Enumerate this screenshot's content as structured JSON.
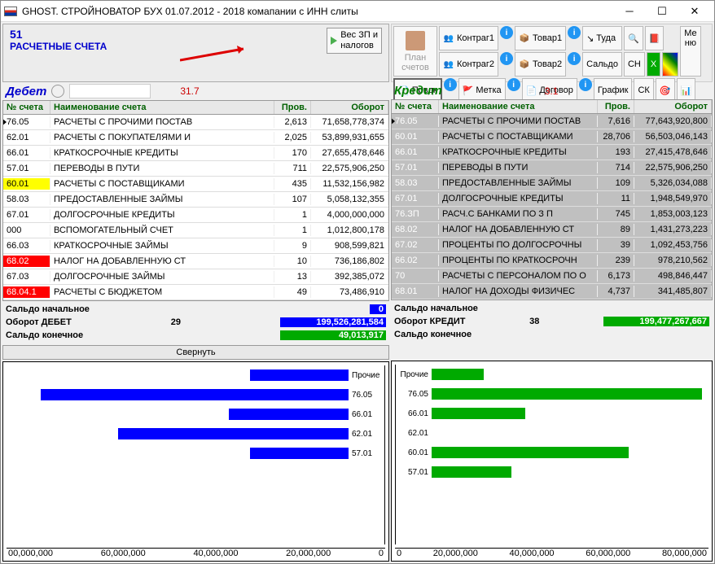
{
  "window": {
    "title": "GHOST. СТРОЙНОВАТОР БУХ 01.07.2012 - 2018 комапании с ИНН слиты"
  },
  "header": {
    "account_no": "51",
    "account_name": "РАСЧЕТНЫЕ СЧЕТА",
    "ves_btn": "Вес ЗП и\nналогов"
  },
  "toolbar": {
    "plan": "План\nсчетов",
    "kontrag1": "Контраг1",
    "kontrag2": "Контраг2",
    "tovar1": "Товар1",
    "tovar2": "Товар2",
    "tuda": "Туда",
    "saldo": "Сальдо",
    "sn": "СН",
    "sk": "СК",
    "menu": "Ме\nню",
    "prvdk": "Првдк",
    "metka": "Метка",
    "dogovor": "Договор",
    "grafik": "График"
  },
  "debit": {
    "label": "Дебет",
    "section_num": "31.7",
    "cols": {
      "num": "№ счета",
      "name": "Наименование счета",
      "prov": "Пров.",
      "obor": "Оборот"
    },
    "rows": [
      {
        "num": "76.05",
        "name": "РАСЧЕТЫ С ПРОЧИМИ ПОСТАВ",
        "prov": "2,613",
        "obor": "71,658,778,374",
        "numcls": ""
      },
      {
        "num": "62.01",
        "name": "РАСЧЕТЫ С ПОКУПАТЕЛЯМИ И",
        "prov": "2,025",
        "obor": "53,899,931,655",
        "numcls": ""
      },
      {
        "num": "66.01",
        "name": "КРАТКОСРОЧНЫЕ КРЕДИТЫ",
        "prov": "170",
        "obor": "27,655,478,646",
        "numcls": ""
      },
      {
        "num": "57.01",
        "name": "ПЕРЕВОДЫ В ПУТИ",
        "prov": "711",
        "obor": "22,575,906,250",
        "numcls": ""
      },
      {
        "num": "60.01",
        "name": "РАСЧЕТЫ С ПОСТАВЩИКАМИ",
        "prov": "435",
        "obor": "11,532,156,982",
        "numcls": "yellow-cell"
      },
      {
        "num": "58.03",
        "name": "ПРЕДОСТАВЛЕННЫЕ ЗАЙМЫ",
        "prov": "107",
        "obor": "5,058,132,355",
        "numcls": ""
      },
      {
        "num": "67.01",
        "name": "ДОЛГОСРОЧНЫЕ КРЕДИТЫ",
        "prov": "1",
        "obor": "4,000,000,000",
        "numcls": ""
      },
      {
        "num": "000",
        "name": "ВСПОМОГАТЕЛЬНЫЙ СЧЕТ",
        "prov": "1",
        "obor": "1,012,800,178",
        "numcls": ""
      },
      {
        "num": "66.03",
        "name": "КРАТКОСРОЧНЫЕ ЗАЙМЫ",
        "prov": "9",
        "obor": "908,599,821",
        "numcls": ""
      },
      {
        "num": "68.02",
        "name": "НАЛОГ НА ДОБАВЛЕННУЮ СТ",
        "prov": "10",
        "obor": "736,186,802",
        "numcls": "red-cell"
      },
      {
        "num": "67.03",
        "name": "ДОЛГОСРОЧНЫЕ ЗАЙМЫ",
        "prov": "13",
        "obor": "392,385,072",
        "numcls": ""
      },
      {
        "num": "68.04.1",
        "name": "РАСЧЕТЫ С БЮДЖЕТОМ",
        "prov": "49",
        "obor": "73,486,910",
        "numcls": "red-cell"
      }
    ],
    "summary": {
      "start_lbl": "Сальдо начальное",
      "start_val": "0",
      "obor_lbl": "Оборот ДЕБЕТ",
      "obor_cnt": "29",
      "obor_val": "199,526,281,584",
      "end_lbl": "Сальдо конечное",
      "end_val": "49,013,917"
    },
    "collapse": "Свернуть"
  },
  "credit": {
    "label": "Кредит",
    "section_num": "3.1",
    "cols": {
      "num": "№ счета",
      "name": "Наименование счета",
      "prov": "Пров.",
      "obor": "Оборот"
    },
    "rows": [
      {
        "num": "76.05",
        "name": "РАСЧЕТЫ С ПРОЧИМИ ПОСТАВ",
        "prov": "7,616",
        "obor": "77,643,920,800"
      },
      {
        "num": "60.01",
        "name": "РАСЧЕТЫ С ПОСТАВЩИКАМИ",
        "prov": "28,706",
        "obor": "56,503,046,143"
      },
      {
        "num": "66.01",
        "name": "КРАТКОСРОЧНЫЕ КРЕДИТЫ",
        "prov": "193",
        "obor": "27,415,478,646"
      },
      {
        "num": "57.01",
        "name": "ПЕРЕВОДЫ В ПУТИ",
        "prov": "714",
        "obor": "22,575,906,250"
      },
      {
        "num": "58.03",
        "name": "ПРЕДОСТАВЛЕННЫЕ ЗАЙМЫ",
        "prov": "109",
        "obor": "5,326,034,088"
      },
      {
        "num": "67.01",
        "name": "ДОЛГОСРОЧНЫЕ КРЕДИТЫ",
        "prov": "11",
        "obor": "1,948,549,970"
      },
      {
        "num": "76.ЗП",
        "name": "РАСЧ.С БАНКАМИ ПО З П",
        "prov": "745",
        "obor": "1,853,003,123"
      },
      {
        "num": "68.02",
        "name": "НАЛОГ НА ДОБАВЛЕННУЮ СТ",
        "prov": "89",
        "obor": "1,431,273,223"
      },
      {
        "num": "67.02",
        "name": "ПРОЦЕНТЫ ПО ДОЛГОСРОЧНЫ",
        "prov": "39",
        "obor": "1,092,453,756"
      },
      {
        "num": "66.02",
        "name": "ПРОЦЕНТЫ ПО КРАТКОСРОЧН",
        "prov": "239",
        "obor": "978,210,562"
      },
      {
        "num": "70",
        "name": "РАСЧЕТЫ С ПЕРСОНАЛОМ ПО О",
        "prov": "6,173",
        "obor": "498,846,447"
      },
      {
        "num": "68.01",
        "name": "НАЛОГ НА ДОХОДЫ ФИЗИЧЕС",
        "prov": "4,737",
        "obor": "341,485,807"
      }
    ],
    "summary": {
      "start_lbl": "Сальдо начальное",
      "obor_lbl": "Оборот КРЕДИТ",
      "obor_cnt": "38",
      "obor_val": "199,477,267,667",
      "end_lbl": "Сальдо конечное"
    }
  },
  "chart_data": [
    {
      "type": "bar",
      "orientation": "horizontal",
      "categories": [
        "Прочие",
        "76.05",
        "66.01",
        "62.01",
        "57.01"
      ],
      "values": [
        23000000000,
        72000000000,
        28000000000,
        54000000000,
        23000000000
      ],
      "xlim": [
        0,
        80000000000
      ],
      "ticks": [
        "00,000,000",
        "60,000,000",
        "40,000,000",
        "20,000,000",
        "0"
      ],
      "color": "#0000ff"
    },
    {
      "type": "bar",
      "orientation": "horizontal",
      "categories": [
        "Прочие",
        "76.05",
        "66.01",
        "62.01",
        "60.01",
        "57.01"
      ],
      "values": [
        15000000000,
        78000000000,
        27000000000,
        0,
        57000000000,
        23000000000
      ],
      "xlim": [
        0,
        80000000000
      ],
      "ticks": [
        "0",
        "20,000,000",
        "40,000,000",
        "60,000,000",
        "80,000,000"
      ],
      "color": "#00aa00"
    }
  ]
}
